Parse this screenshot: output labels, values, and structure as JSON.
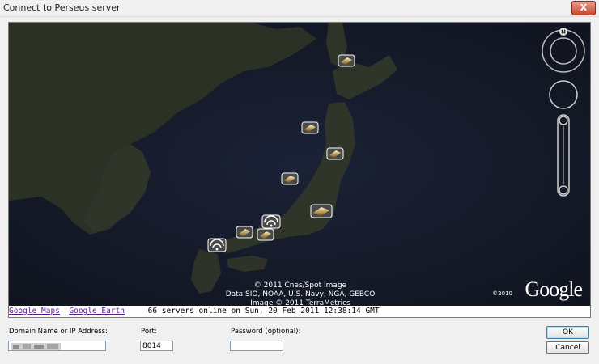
{
  "window": {
    "title": "Connect to Perseus server",
    "close_label": "X"
  },
  "map": {
    "credits": [
      "© 2011 Cnes/Spot Image",
      "Data SIO, NOAA, U.S. Navy, NGA, GEBCO",
      "Image © 2011 TerraMetrics"
    ],
    "logo": "Google",
    "logo_year": "©2010",
    "compass_letter": "N"
  },
  "linkbar": {
    "maps_link": "Google Maps",
    "earth_link": "Google Earth",
    "status": "66 servers online on  Sun, 20 Feb 2011 12:38:14 GMT"
  },
  "form": {
    "domain_label": "Domain Name or IP Address:",
    "domain_value": "",
    "port_label": "Port:",
    "port_value": "8014",
    "password_label": "Password  (optional):",
    "password_value": ""
  },
  "buttons": {
    "ok": "OK",
    "cancel": "Cancel"
  },
  "colors": {
    "ocean": "#151b2c",
    "land": "#2e3228",
    "accent": "#c8462c"
  }
}
